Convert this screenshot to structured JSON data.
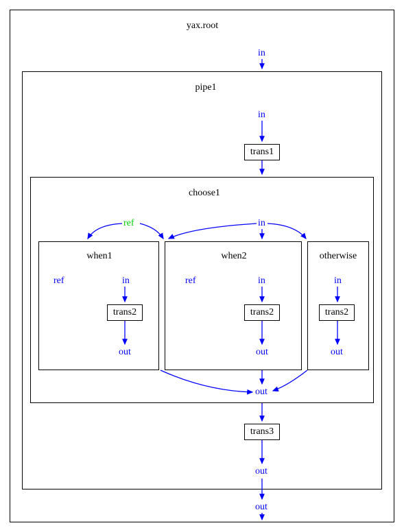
{
  "root": {
    "title": "yax.root",
    "in": "in",
    "out": "out"
  },
  "pipe1": {
    "title": "pipe1",
    "in": "in",
    "out": "out"
  },
  "trans1": {
    "label": "trans1"
  },
  "choose1": {
    "title": "choose1",
    "ref": "ref",
    "in": "in",
    "out": "out"
  },
  "when1": {
    "title": "when1",
    "ref": "ref",
    "in": "in",
    "out": "out",
    "trans": "trans2"
  },
  "when2": {
    "title": "when2",
    "ref": "ref",
    "in": "in",
    "out": "out",
    "trans": "trans2"
  },
  "otherwise": {
    "title": "otherwise",
    "in": "in",
    "out": "out",
    "trans": "trans2"
  },
  "trans3": {
    "label": "trans3"
  },
  "chart_data": {
    "type": "diagram",
    "title": "yax.root pipeline diagram",
    "nodes": [
      {
        "id": "yax.root",
        "type": "container",
        "children": [
          "pipe1"
        ],
        "ports": [
          "in",
          "out"
        ]
      },
      {
        "id": "pipe1",
        "type": "container",
        "children": [
          "trans1",
          "choose1",
          "trans3"
        ],
        "ports": [
          "in",
          "out"
        ]
      },
      {
        "id": "trans1",
        "type": "transform"
      },
      {
        "id": "choose1",
        "type": "choose",
        "children": [
          "when1",
          "when2",
          "otherwise"
        ],
        "ports": [
          "ref",
          "in",
          "out"
        ]
      },
      {
        "id": "when1",
        "type": "when",
        "children": [
          "trans2"
        ],
        "ports": [
          "ref",
          "in",
          "out"
        ]
      },
      {
        "id": "when2",
        "type": "when",
        "children": [
          "trans2"
        ],
        "ports": [
          "ref",
          "in",
          "out"
        ]
      },
      {
        "id": "otherwise",
        "type": "otherwise",
        "children": [
          "trans2"
        ],
        "ports": [
          "in",
          "out"
        ]
      },
      {
        "id": "trans3",
        "type": "transform"
      }
    ],
    "edges": [
      {
        "from": "yax.root.in",
        "to": "pipe1.in"
      },
      {
        "from": "pipe1.in",
        "to": "trans1"
      },
      {
        "from": "trans1",
        "to": "choose1.in"
      },
      {
        "from": "choose1.ref",
        "to": "when1.top"
      },
      {
        "from": "choose1.ref",
        "to": "when2.top"
      },
      {
        "from": "choose1.in",
        "to": "when2.top"
      },
      {
        "from": "choose1.in",
        "to": "otherwise.top"
      },
      {
        "from": "when1.in",
        "to": "when1.trans2"
      },
      {
        "from": "when2.in",
        "to": "when2.trans2"
      },
      {
        "from": "otherwise.in",
        "to": "otherwise.trans2"
      },
      {
        "from": "when1.trans2",
        "to": "when1.out"
      },
      {
        "from": "when2.trans2",
        "to": "when2.out"
      },
      {
        "from": "otherwise.trans2",
        "to": "otherwise.out"
      },
      {
        "from": "when1.bottom",
        "to": "choose1.out"
      },
      {
        "from": "when2.bottom",
        "to": "choose1.out"
      },
      {
        "from": "otherwise.bottom",
        "to": "choose1.out"
      },
      {
        "from": "choose1.out",
        "to": "trans3"
      },
      {
        "from": "trans3",
        "to": "pipe1.out"
      },
      {
        "from": "pipe1.out",
        "to": "yax.root.out"
      }
    ]
  }
}
